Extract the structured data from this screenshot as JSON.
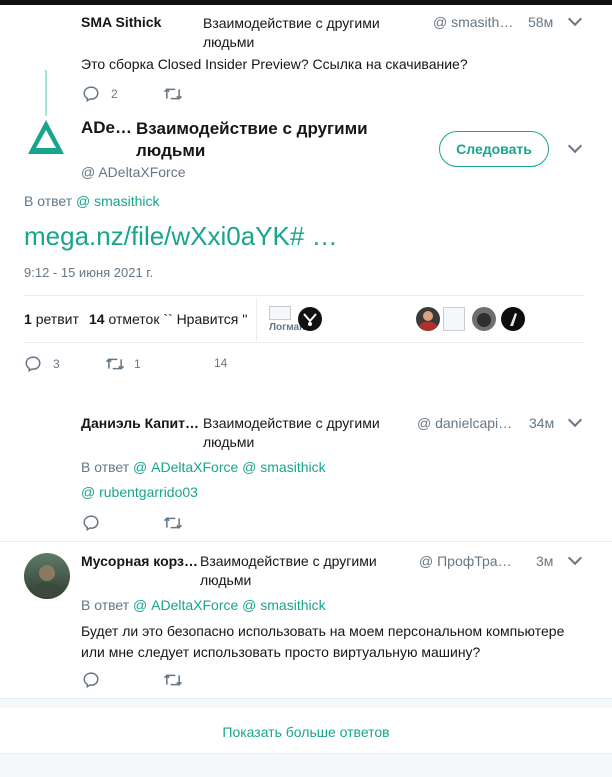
{
  "tweet1": {
    "name": "SMA Sithick",
    "context": "Взаимодействие с другими людьми",
    "handle": "@ smasith…",
    "time": "58м",
    "text": "Это сборка Closed Insider Preview? Ссылка на скачивание?",
    "reply_count": "2"
  },
  "main_tweet": {
    "name": "ADe…",
    "context": "Взаимодействие с другими людьми",
    "handle": "@ ADeltaXForce",
    "follow_label": "Следовать",
    "reply_to_prefix": "В ответ",
    "reply_to_handle": "@ smasithick",
    "link": "mega.nz/file/wXxi0aYK#  …",
    "timestamp": "9:12 - 15 июня 2021 г.",
    "retweet_count": "1",
    "retweet_label": "ретвит",
    "likes_count": "14",
    "likes_label": "отметок `` Нравится ''",
    "liker_alt_label": "Логман",
    "action_reply_count": "3",
    "action_retweet_count": "1",
    "action_like_count": "14"
  },
  "tweet2": {
    "name": "Даниэль Капит…",
    "context": "Взаимодействие с другими людьми",
    "handle": "@ danielcapi…",
    "time": "34м",
    "reply_to_prefix": "В ответ",
    "reply_to_handles": "@ ADeltaXForce @ smasithick",
    "reply_to_handles_2": "@ rubentgarrido03"
  },
  "tweet3": {
    "name": "Мусорная корз…",
    "context": "Взаимодействие с другими людьми",
    "handle": "@ ПрофТра…",
    "time": "3м",
    "reply_to_prefix": "В ответ",
    "reply_to_handles": "@ ADeltaXForce @ smasithick",
    "text": "Будет ли это безопасно использовать на моем персональном компьютере или мне следует использовать просто виртуальную машину?"
  },
  "show_more_label": "Показать больше ответов",
  "colors": {
    "accent": "#17a58d",
    "muted": "#657786",
    "text": "#14171a",
    "divider": "#e6ecf0"
  },
  "icons": [
    "reply-icon",
    "retweet-icon",
    "chevron-down-icon",
    "like-icon"
  ]
}
